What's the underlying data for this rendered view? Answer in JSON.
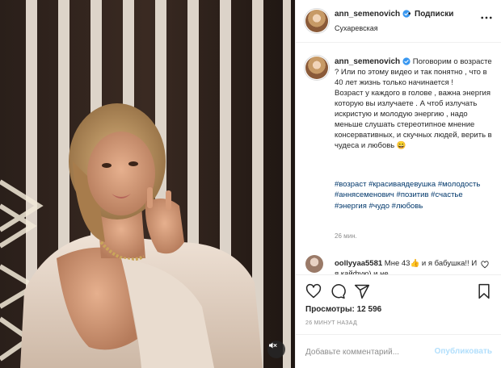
{
  "header": {
    "username": "ann_semenovich",
    "separator": "•",
    "follow_label": "Подписки",
    "location": "Сухаревская"
  },
  "caption": {
    "username": "ann_semenovich",
    "text": "Поговорим о возрасте ? Или по этому видео и так понятно , что в 40 лет жизнь только начинается !\nВозраст у каждого в голове , важна энергия которую вы излучаете . А чтоб излучать искристую и молодую энергию , надо меньше слушать стереотипное мнение консервативных, и скучных людей, верить в чудеса и любовь 😄",
    "hashtags": [
      "#возраст",
      "#красиваядевушка",
      "#молодость",
      "#аннясеменович",
      "#позитив",
      "#счастье",
      "#энергия",
      "#чудо",
      "#любовь"
    ],
    "time": "26 мин."
  },
  "comment": {
    "username": "oollyyaa5581",
    "text": "Мне 43👍 и я бабушка!! И я кайфую) и не"
  },
  "actions": {
    "views_label": "Просмотры: 12 596",
    "time_ago": "26 МИНУТ НАЗАД"
  },
  "add_comment": {
    "placeholder": "Добавьте комментарий...",
    "publish_label": "Опубликовать"
  },
  "icons": {
    "verified": "verified-badge-icon",
    "more": "more-options-icon",
    "like": "heart-icon",
    "comment": "comment-icon",
    "share": "share-icon",
    "save": "bookmark-icon",
    "sound": "sound-off-icon"
  },
  "colors": {
    "verified": "#3897f0",
    "hashtag": "#00376b",
    "publish_disabled": "#b2dffc",
    "muted": "#8e8e8e"
  }
}
